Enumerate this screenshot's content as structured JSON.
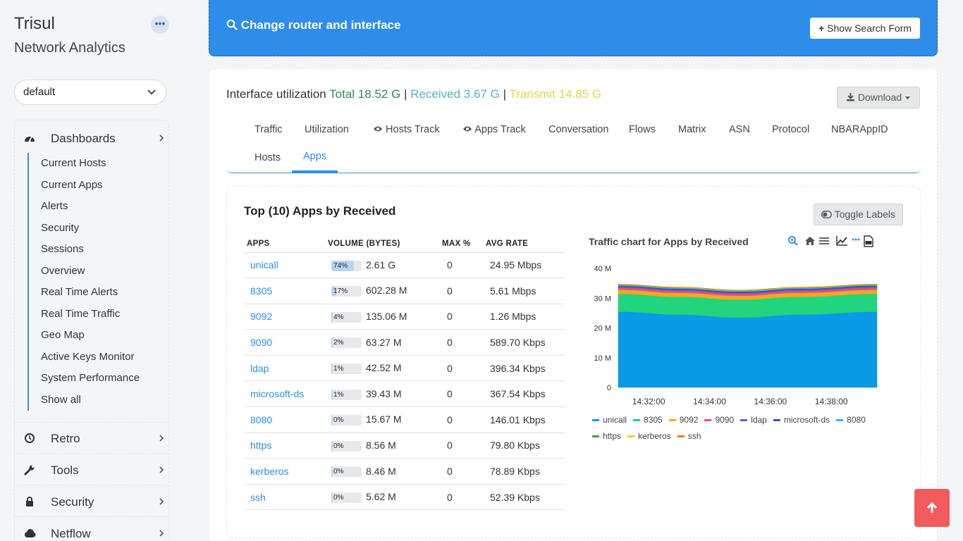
{
  "brand": {
    "title": "Trisul",
    "subtitle": "Network Analytics",
    "more_icon": "ellipsis-icon"
  },
  "router_select": {
    "value": "default"
  },
  "sidebar": {
    "groups": [
      {
        "label": "Dashboards",
        "icon": "dashboard-icon"
      },
      {
        "label": "Retro",
        "icon": "clock-icon"
      },
      {
        "label": "Tools",
        "icon": "wrench-icon"
      },
      {
        "label": "Security",
        "icon": "lock-icon"
      },
      {
        "label": "Netflow",
        "icon": "cloud-icon"
      }
    ],
    "dashboard_items": [
      "Current Hosts",
      "Current Apps",
      "Alerts",
      "Security",
      "Sessions",
      "Overview",
      "Real Time Alerts",
      "Real Time Traffic",
      "Geo Map",
      "Active Keys Monitor",
      "System Performance",
      "Show all"
    ]
  },
  "banner": {
    "title": "Change router and interface",
    "button": "Show Search Form"
  },
  "util": {
    "label": "Interface utilization",
    "total": "Total 18.52 G",
    "received": "Received 3.67 G",
    "transmit": "Transmit 14.85 G",
    "sep": "|",
    "colors": {
      "total": "#2e8b57",
      "received": "#4db6c4",
      "transmit": "#e6d44a"
    }
  },
  "download": "Download",
  "tabs": [
    "Traffic",
    "Utilization",
    "Hosts Track",
    "Apps Track",
    "Conversation",
    "Flows",
    "Matrix",
    "ASN",
    "Protocol",
    "NBARAppID",
    "Hosts",
    "Apps"
  ],
  "active_tab": "Apps",
  "panel": {
    "title": "Top (10) Apps by Received",
    "toggle": "Toggle Labels"
  },
  "table": {
    "headers": [
      "APPS",
      "VOLUME (BYTES)",
      "MAX %",
      "AVG RATE"
    ],
    "rows": [
      {
        "app": "unicall",
        "pct": "74%",
        "fill": 0.74,
        "volume": "2.61 G",
        "max": "0",
        "rate": "24.95 Mbps"
      },
      {
        "app": "8305",
        "pct": "17%",
        "fill": 0.17,
        "volume": "602.28 M",
        "max": "0",
        "rate": "5.61 Mbps"
      },
      {
        "app": "9092",
        "pct": "4%",
        "fill": 0.04,
        "volume": "135.06 M",
        "max": "0",
        "rate": "1.26 Mbps"
      },
      {
        "app": "9090",
        "pct": "2%",
        "fill": 0.02,
        "volume": "63.27 M",
        "max": "0",
        "rate": "589.70 Kbps"
      },
      {
        "app": "ldap",
        "pct": "1%",
        "fill": 0.01,
        "volume": "42.52 M",
        "max": "0",
        "rate": "396.34 Kbps"
      },
      {
        "app": "microsoft-ds",
        "pct": "1%",
        "fill": 0.01,
        "volume": "39.43 M",
        "max": "0",
        "rate": "367.54 Kbps"
      },
      {
        "app": "8080",
        "pct": "0%",
        "fill": 0,
        "volume": "15.67 M",
        "max": "0",
        "rate": "146.01 Kbps"
      },
      {
        "app": "https",
        "pct": "0%",
        "fill": 0,
        "volume": "8.56 M",
        "max": "0",
        "rate": "79.80 Kbps"
      },
      {
        "app": "kerberos",
        "pct": "0%",
        "fill": 0,
        "volume": "8.46 M",
        "max": "0",
        "rate": "78.89 Kbps"
      },
      {
        "app": "ssh",
        "pct": "0%",
        "fill": 0,
        "volume": "5.62 M",
        "max": "0",
        "rate": "52.39 Kbps"
      }
    ]
  },
  "chart_data": {
    "type": "area",
    "title": "Traffic chart for Apps by Received",
    "xlabel": "",
    "ylabel": "",
    "x": [
      "14:31:00",
      "14:33:00",
      "14:35:00",
      "14:37:00",
      "14:39:30"
    ],
    "x_ticks": [
      "14:32:00",
      "14:34:00",
      "14:36:00",
      "14:38:00"
    ],
    "y_ticks": [
      "40 M",
      "30 M",
      "20 M",
      "10 M",
      "0"
    ],
    "ylim": [
      0,
      40
    ],
    "stacked": true,
    "series": [
      {
        "name": "unicall",
        "color": "#0a9ae6",
        "values": [
          25.5,
          24.5,
          23.5,
          24.5,
          25.5
        ]
      },
      {
        "name": "8305",
        "color": "#22d47e",
        "values": [
          6.0,
          6.0,
          6.0,
          6.0,
          6.0
        ]
      },
      {
        "name": "9092",
        "color": "#f2a81d",
        "values": [
          1.3,
          1.3,
          1.3,
          1.3,
          1.3
        ]
      },
      {
        "name": "9090",
        "color": "#f0506e",
        "values": [
          0.6,
          0.6,
          0.6,
          0.6,
          0.6
        ]
      },
      {
        "name": "ldap",
        "color": "#7e57c2",
        "values": [
          0.4,
          0.4,
          0.4,
          0.4,
          0.4
        ]
      },
      {
        "name": "microsoft-ds",
        "color": "#3f51b5",
        "values": [
          0.4,
          0.4,
          0.4,
          0.4,
          0.4
        ]
      },
      {
        "name": "8080",
        "color": "#29b6f6",
        "values": [
          0.2,
          0.2,
          0.2,
          0.2,
          0.2
        ]
      },
      {
        "name": "https",
        "color": "#43a047",
        "values": [
          0.1,
          0.1,
          0.1,
          0.1,
          0.1
        ]
      },
      {
        "name": "kerberos",
        "color": "#e6d22a",
        "values": [
          0.1,
          0.1,
          0.1,
          0.1,
          0.1
        ]
      },
      {
        "name": "ssh",
        "color": "#f57c00",
        "values": [
          0.1,
          0.1,
          0.1,
          0.1,
          0.1
        ]
      }
    ],
    "legend": "bottom"
  }
}
